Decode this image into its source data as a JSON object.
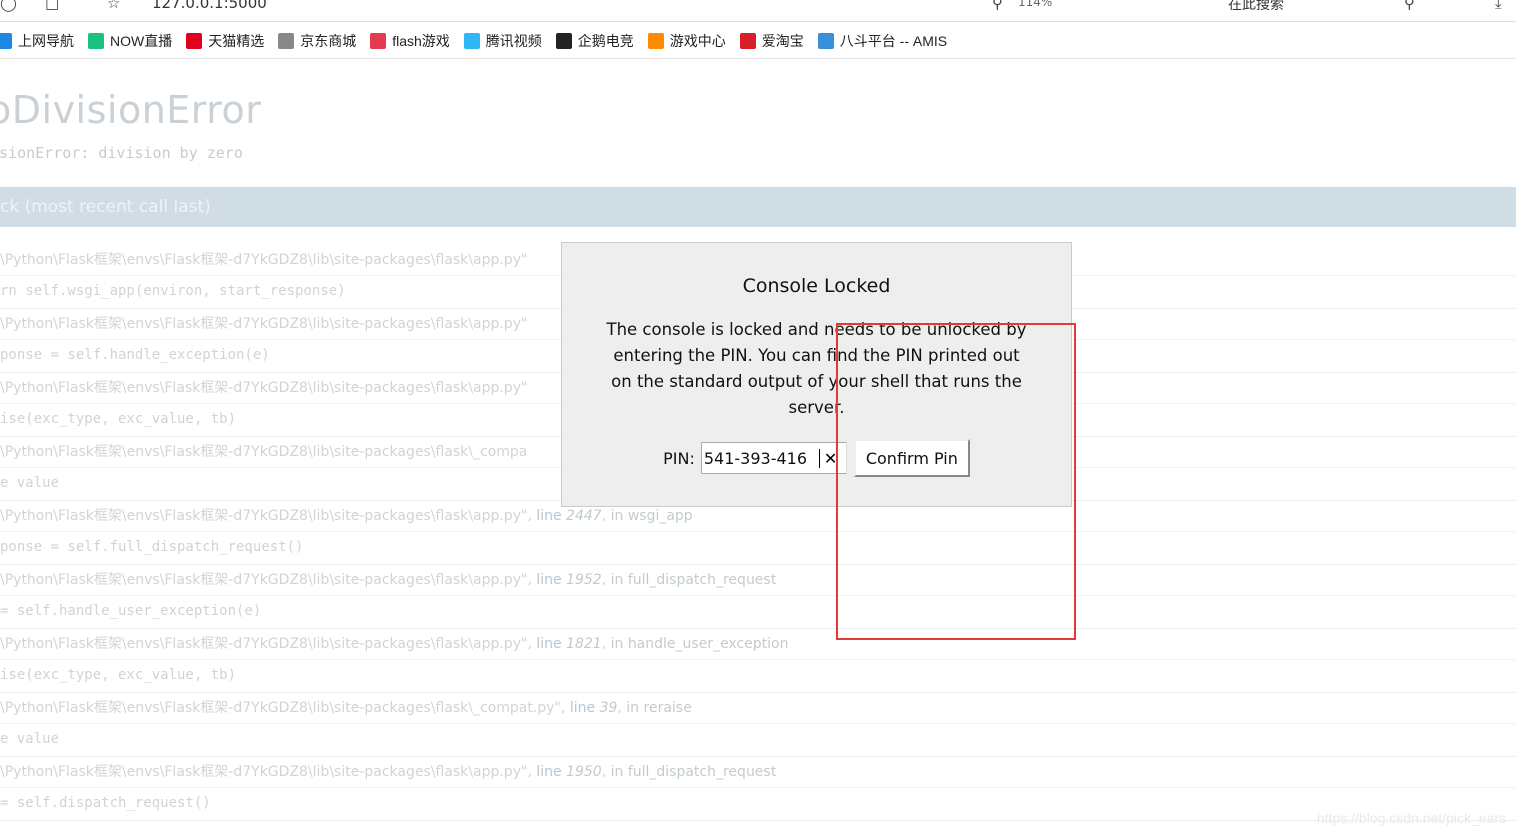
{
  "browser": {
    "url": "127.0.0.1:5000",
    "zoom": "114%",
    "search_placeholder": "在此搜索",
    "bookmarks": [
      {
        "label": "上网导航",
        "icon": "ie-icon",
        "color": "#1e88e5"
      },
      {
        "label": "NOW直播",
        "icon": "now-icon",
        "color": "#19c37d"
      },
      {
        "label": "天猫精选",
        "icon": "tmall-icon",
        "color": "#e1001e"
      },
      {
        "label": "京东商城",
        "icon": "globe-icon",
        "color": "#888888"
      },
      {
        "label": "flash游戏",
        "icon": "flash-icon",
        "color": "#e53950"
      },
      {
        "label": "腾讯视频",
        "icon": "play-icon",
        "color": "#2db7f5"
      },
      {
        "label": "企鹅电竞",
        "icon": "penguin-icon",
        "color": "#222222"
      },
      {
        "label": "游戏中心",
        "icon": "gamepad-icon",
        "color": "#ff8a00"
      },
      {
        "label": "爱淘宝",
        "icon": "taobao-icon",
        "color": "#d81e28"
      },
      {
        "label": "八斗平台 -- AMIS",
        "icon": "a-icon",
        "color": "#3a8fd9"
      }
    ]
  },
  "page": {
    "error_title": "ZeroDivisionError",
    "error_title_visible": "oDivisionError",
    "error_message": "isionError: division by zero",
    "traceback_header": "ck (most recent call last)",
    "frames": [
      {
        "path": "\\Python\\Flask框架\\envs\\Flask框架-d7YkGDZ8\\lib\\site-packages\\flask\\app.py\"",
        "line": "",
        "func": "",
        "code": "rn self.wsgi_app(environ, start_response)"
      },
      {
        "path": "\\Python\\Flask框架\\envs\\Flask框架-d7YkGDZ8\\lib\\site-packages\\flask\\app.py\"",
        "line": "",
        "func": "",
        "code": "ponse = self.handle_exception(e)"
      },
      {
        "path": "\\Python\\Flask框架\\envs\\Flask框架-d7YkGDZ8\\lib\\site-packages\\flask\\app.py\"",
        "line": "",
        "func": "",
        "code": "ise(exc_type, exc_value, tb)"
      },
      {
        "path": "\\Python\\Flask框架\\envs\\Flask框架-d7YkGDZ8\\lib\\site-packages\\flask\\_compa",
        "line": "",
        "func": "",
        "code": "e value"
      },
      {
        "path": "\\Python\\Flask框架\\envs\\Flask框架-d7YkGDZ8\\lib\\site-packages\\flask\\app.py\"",
        "line": "2447",
        "func": "wsgi_app",
        "code": "ponse = self.full_dispatch_request()"
      },
      {
        "path": "\\Python\\Flask框架\\envs\\Flask框架-d7YkGDZ8\\lib\\site-packages\\flask\\app.py\"",
        "line": "1952",
        "func": "full_dispatch_request",
        "code": "= self.handle_user_exception(e)"
      },
      {
        "path": "\\Python\\Flask框架\\envs\\Flask框架-d7YkGDZ8\\lib\\site-packages\\flask\\app.py\"",
        "line": "1821",
        "func": "handle_user_exception",
        "code": "ise(exc_type, exc_value, tb)"
      },
      {
        "path": "\\Python\\Flask框架\\envs\\Flask框架-d7YkGDZ8\\lib\\site-packages\\flask\\_compat.py\"",
        "line": "39",
        "func": "reraise",
        "code": "e value"
      },
      {
        "path": "\\Python\\Flask框架\\envs\\Flask框架-d7YkGDZ8\\lib\\site-packages\\flask\\app.py\"",
        "line": "1950",
        "func": "full_dispatch_request",
        "code": "= self.dispatch_request()"
      }
    ],
    "line_word": "line",
    "in_word": "in",
    "watermark": "https://blog.csdn.net/pick_ears"
  },
  "modal": {
    "title": "Console Locked",
    "message": "The console is locked and needs to be unlocked by entering the PIN. You can find the PIN printed out on the standard output of your shell that runs the server.",
    "pin_label": "PIN:",
    "pin_value": "541-393-416",
    "clear_symbol": "✕",
    "confirm_label": "Confirm Pin"
  },
  "annotation_color": "#e53935"
}
